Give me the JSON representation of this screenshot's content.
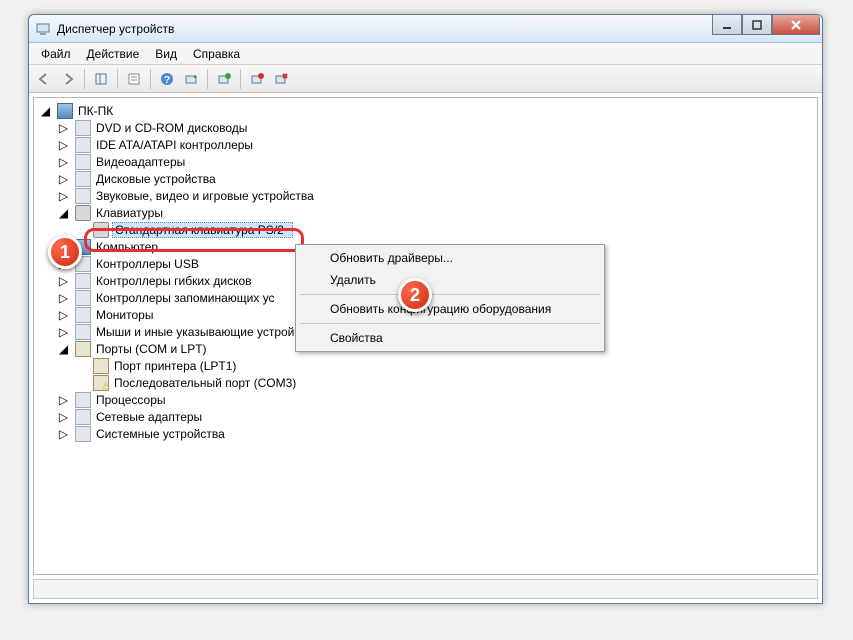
{
  "window": {
    "title": "Диспетчер устройств"
  },
  "menu": {
    "file": "Файл",
    "action": "Действие",
    "view": "Вид",
    "help": "Справка"
  },
  "tree": {
    "root": "ПК-ПК",
    "items": [
      "DVD и CD-ROM дисководы",
      "IDE ATA/ATAPI контроллеры",
      "Видеоадаптеры",
      "Дисковые устройства",
      "Звуковые, видео и игровые устройства",
      "Клавиатуры"
    ],
    "selected": "Стандартная клавиатура PS/2",
    "after": [
      "Компьютер",
      "Контроллеры USB",
      "Контроллеры гибких дисков",
      "Контроллеры запоминающих ус",
      "Мониторы",
      "Мыши и иные указывающие устройства",
      "Порты (COM и LPT)"
    ],
    "ports": [
      "Порт принтера (LPT1)",
      "Последовательный порт (COM3)"
    ],
    "tail": [
      "Процессоры",
      "Сетевые адаптеры",
      "Системные устройства"
    ]
  },
  "context": {
    "update_drivers": "Обновить драйверы...",
    "delete": "Удалить",
    "scan": "Обновить конфигурацию оборудования",
    "properties": "Свойства"
  },
  "badges": {
    "one": "1",
    "two": "2"
  }
}
